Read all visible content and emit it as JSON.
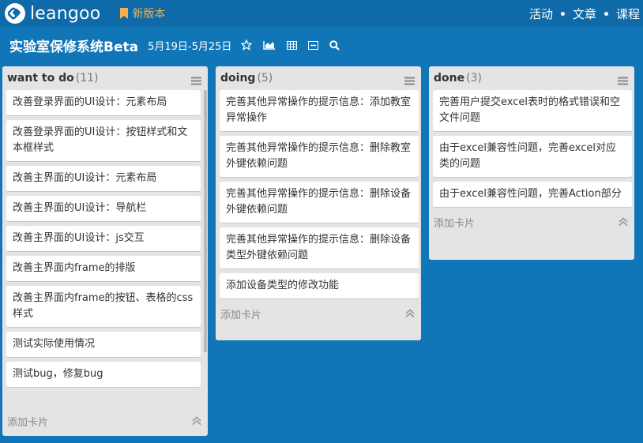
{
  "app": {
    "name": "leangoo",
    "new_version": "新版本"
  },
  "topnav": [
    "活动",
    "文章",
    "课程"
  ],
  "board": {
    "title": "实验室保修系统Beta",
    "date_range": "5月19日-5月25日"
  },
  "lists": [
    {
      "name": "want to do",
      "count": "(11)",
      "cards": [
        "改善登录界面的UI设计：元素布局",
        "改善登录界面的UI设计：按钮样式和文本框样式",
        "改善主界面的UI设计：元素布局",
        "改善主界面的UI设计：导航栏",
        "改善主界面的UI设计：js交互",
        "改善主界面内frame的排版",
        "改善主界面内frame的按钮、表格的css样式",
        "测试实际使用情况",
        "测试bug，修复bug"
      ],
      "add_card": "添加卡片"
    },
    {
      "name": "doing",
      "count": "(5)",
      "cards": [
        "完善其他异常操作的提示信息：添加教室异常操作",
        "完善其他异常操作的提示信息：删除教室外键依赖问题",
        "完善其他异常操作的提示信息：删除设备外键依赖问题",
        "完善其他异常操作的提示信息：删除设备类型外键依赖问题",
        "添加设备类型的修改功能"
      ],
      "add_card": "添加卡片"
    },
    {
      "name": "done",
      "count": "(3)",
      "cards": [
        "完善用户提交excel表时的格式错误和空文件问题",
        "由于excel兼容性问题，完善excel对应类的问题",
        "由于excel兼容性问题，完善Action部分"
      ],
      "add_card": "添加卡片"
    }
  ],
  "icons": {
    "logo": "leangoo-logo-icon",
    "bookmark": "bookmark-icon",
    "star": "star-icon",
    "chart": "area-chart-icon",
    "table": "table-icon",
    "board": "board-icon",
    "search": "search-icon",
    "menu": "menu-icon",
    "collapse": "chevron-up-icon"
  },
  "colors": {
    "background": "#1176b8",
    "topbar": "#0e6aa8",
    "accent": "#f4b04a"
  }
}
